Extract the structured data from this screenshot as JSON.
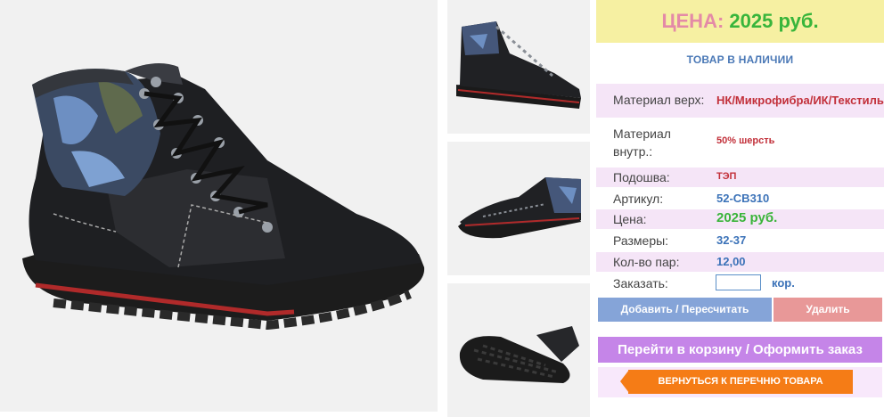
{
  "gallery": {
    "main_image": "boot-main-photo",
    "thumbnails": [
      "boot-side-view",
      "boot-angle-view",
      "boot-sole-view"
    ]
  },
  "price_banner": {
    "label": "ЦЕНА:",
    "value": "2025 руб."
  },
  "stock_status": "ТОВАР В НАЛИЧИИ",
  "specs": [
    {
      "key": "Материал верх:",
      "value": "НК/Микрофибра/ИК/Текстиль"
    },
    {
      "key_line1": "Материал",
      "key_line2": "внутр.:",
      "value": "50% шерсть"
    },
    {
      "key": "Подошва:",
      "value": "ТЭП"
    },
    {
      "key": "Артикул:",
      "value": "52-CB310"
    },
    {
      "key": "Цена:",
      "value": "2025 руб."
    },
    {
      "key": "Размеры:",
      "value": "32-37"
    },
    {
      "key": "Кол-во пар:",
      "value": "12,00"
    }
  ],
  "order": {
    "label": "Заказать:",
    "value": "",
    "unit": "кор."
  },
  "buttons": {
    "add": "Добавить / Пересчитать",
    "remove": "Удалить",
    "cart": "Перейти в корзину / Оформить заказ",
    "back": "ВЕРНУТЬСЯ К ПЕРЕЧНЮ ТОВАРА"
  },
  "colors": {
    "price_label": "#e48aa7",
    "price_value": "#38b53b",
    "stock": "#4a78b6",
    "add_button": "#85a4d8",
    "remove_button": "#e89898",
    "cart_button": "#c585e8",
    "back_button": "#f57c16"
  }
}
